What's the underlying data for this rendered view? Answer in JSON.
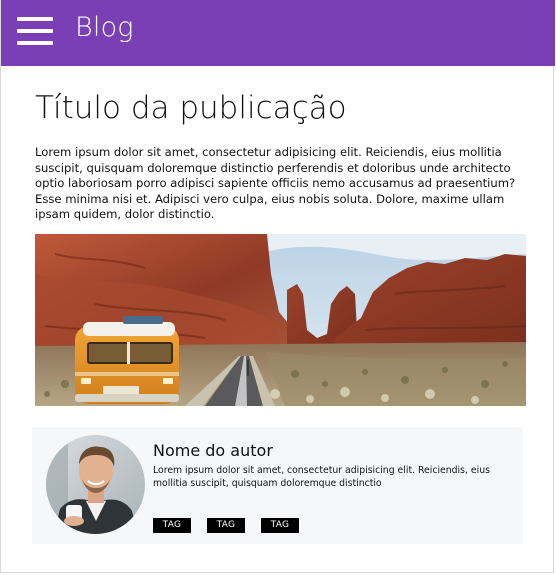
{
  "header": {
    "brand": "Blog",
    "menu_icon": "hamburger-menu-icon",
    "background": "#7b3fb5"
  },
  "post": {
    "title": "Título da publicação",
    "body": "Lorem ipsum dolor sit amet, consectetur adipisicing elit. Reiciendis, eius mollitia suscipit, quisquam doloremque distinctio perferendis et doloribus unde architecto optio laboriosam porro adipisci sapiente officiis nemo accusamus ad praesentium? Esse minima nisi et. Adipisci vero culpa, eius nobis soluta. Dolore, maxime ullam ipsam quidem, dolor distinctio."
  },
  "author": {
    "name": "Nome do autor",
    "bio": "Lorem ipsum dolor sit amet, consectetur adipisicing elit. Reiciendis, eius mollitia suscipit, quisquam doloremque distinctio",
    "tags": [
      "TAG",
      "TAG",
      "TAG"
    ]
  },
  "colors": {
    "accent": "#7b3fb5",
    "tag_bg": "#000000",
    "card_bg": "#f6f7f9"
  }
}
